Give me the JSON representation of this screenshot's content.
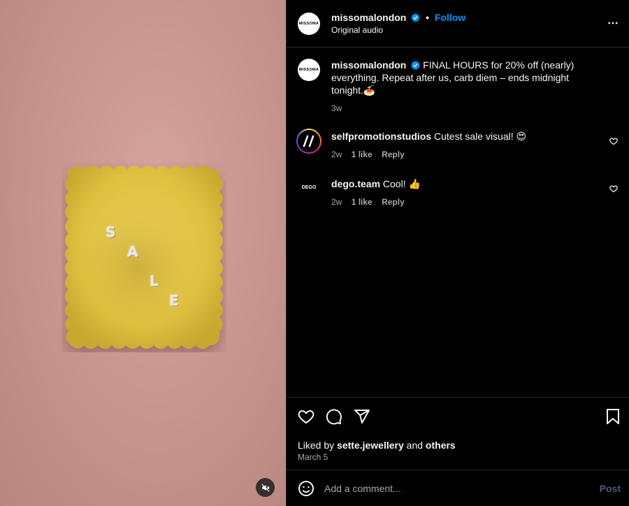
{
  "header": {
    "username": "missomalondon",
    "avatar_text": "MISSOMA",
    "follow_label": "Follow",
    "separator": "•",
    "audio": "Original audio"
  },
  "media": {
    "letters": [
      "S",
      "A",
      "L",
      "E"
    ],
    "mute_icon": "speaker-muted-icon"
  },
  "caption": {
    "username": "missomalondon",
    "text": "FINAL HOURS for 20% off (nearly) everything. Repeat after us, carb diem – ends midnight tonight.🍝",
    "time": "3w"
  },
  "comments": [
    {
      "username": "selfpromotionstudios",
      "text": "Cutest sale visual! 😍",
      "time": "2w",
      "likes": "1 like",
      "reply": "Reply"
    },
    {
      "username": "dego.team",
      "avatar_text": "DEGO",
      "text": "Cool! 👍",
      "time": "2w",
      "likes": "1 like",
      "reply": "Reply"
    }
  ],
  "likes": {
    "prefix": "Liked by",
    "user": "sette.jewellery",
    "and": "and",
    "others": "others",
    "date": "March 5"
  },
  "composer": {
    "placeholder": "Add a comment...",
    "post_label": "Post"
  },
  "colors": {
    "accent": "#0095f6",
    "verified": "#0095f6",
    "background": "#000000",
    "muted_text": "#a8a8a8",
    "media_bg": "#c9968f",
    "pasta": "#e6c84a"
  }
}
